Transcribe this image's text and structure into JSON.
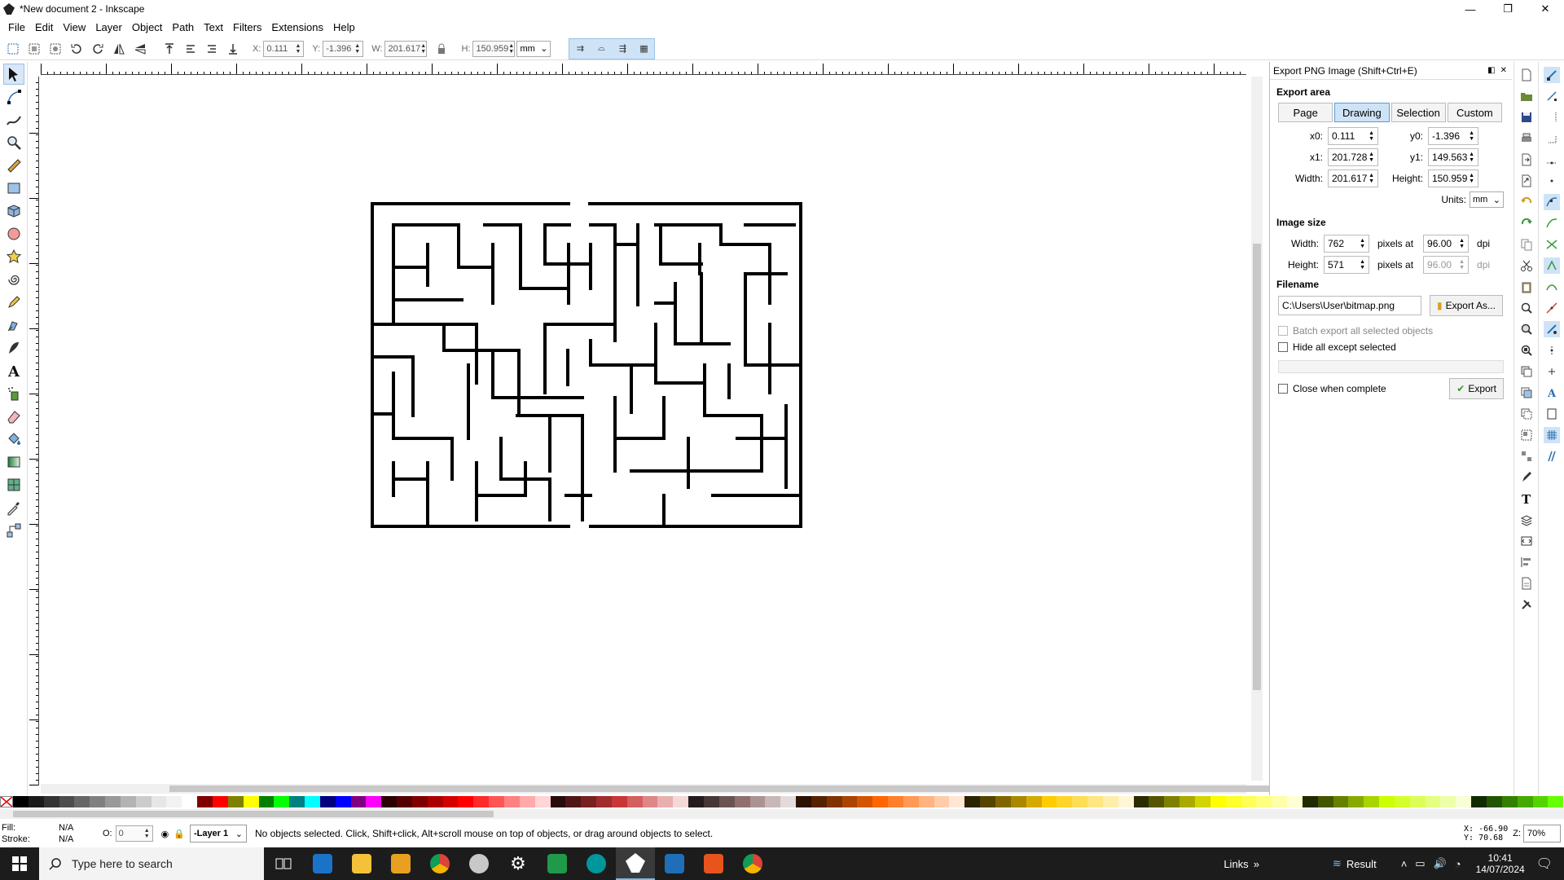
{
  "window": {
    "title": "*New document 2 - Inkscape",
    "minimize": "—",
    "restore": "❐",
    "close": "✕"
  },
  "menu": [
    "File",
    "Edit",
    "View",
    "Layer",
    "Object",
    "Path",
    "Text",
    "Filters",
    "Extensions",
    "Help"
  ],
  "toolbar": {
    "x_label": "X:",
    "x_value": "0.111",
    "y_label": "Y:",
    "y_value": "-1.396",
    "w_label": "W:",
    "w_value": "201.617",
    "h_label": "H:",
    "h_value": "150.959",
    "unit": "mm"
  },
  "export_panel": {
    "title": "Export PNG Image (Shift+Ctrl+E)",
    "export_area_title": "Export area",
    "area_buttons": [
      "Page",
      "Drawing",
      "Selection",
      "Custom"
    ],
    "selected_area": "Drawing",
    "x0_label": "x0:",
    "x0": "0.111",
    "y0_label": "y0:",
    "y0": "-1.396",
    "x1_label": "x1:",
    "x1": "201.728",
    "y1_label": "y1:",
    "y1": "149.563",
    "width_label": "Width:",
    "width": "201.617",
    "height_label": "Height:",
    "height": "150.959",
    "units_label": "Units:",
    "units": "mm",
    "image_size_title": "Image size",
    "img_width_label": "Width:",
    "img_width": "762",
    "img_height_label": "Height:",
    "img_height": "571",
    "pixels_at": "pixels at",
    "dpi_x": "96.00",
    "dpi_y": "96.00",
    "dpi": "dpi",
    "filename_title": "Filename",
    "filename": "C:\\Users\\User\\bitmap.png",
    "export_as": "Export As...",
    "batch_export": "Batch export all selected objects",
    "hide_except": "Hide all except selected",
    "close_when_complete": "Close when complete",
    "export": "Export"
  },
  "status": {
    "fill_label": "Fill:",
    "fill_value": "N/A",
    "stroke_label": "Stroke:",
    "stroke_value": "N/A",
    "opacity_label": "O:",
    "opacity_value": "0",
    "layer": "-Layer 1",
    "message": "No objects selected. Click, Shift+click, Alt+scroll mouse on top of objects, or drag around objects to select.",
    "x_coord": "X: -66.90",
    "y_coord": "Y:  70.68",
    "zoom_label": "Z:",
    "zoom": "70%"
  },
  "taskbar": {
    "search_placeholder": "Type here to search",
    "links": "Links",
    "result": "Result",
    "time": "10:41",
    "date": "14/07/2024"
  },
  "palette": [
    "#000000",
    "#1a1a1a",
    "#333333",
    "#4d4d4d",
    "#666666",
    "#808080",
    "#999999",
    "#b3b3b3",
    "#cccccc",
    "#e6e6e6",
    "#f2f2f2",
    "#ffffff",
    "#800000",
    "#ff0000",
    "#808000",
    "#ffff00",
    "#008000",
    "#00ff00",
    "#008080",
    "#00ffff",
    "#000080",
    "#0000ff",
    "#800080",
    "#ff00ff",
    "#2b0000",
    "#550000",
    "#800000",
    "#aa0000",
    "#d40000",
    "#ff0000",
    "#ff2a2a",
    "#ff5555",
    "#ff8080",
    "#ffaaaa",
    "#ffd5d5",
    "#280b0b",
    "#501616",
    "#782121",
    "#a02c2c",
    "#c83737",
    "#d35f5f",
    "#de8787",
    "#e9afaf",
    "#f4d7d7",
    "#241c1c",
    "#483737",
    "#6c5353",
    "#916f6f",
    "#ac9393",
    "#c8b7b7",
    "#e3dbdb",
    "#2b1100",
    "#552200",
    "#803300",
    "#aa4400",
    "#d45500",
    "#ff6600",
    "#ff7f2a",
    "#ff9955",
    "#ffb380",
    "#ffccaa",
    "#ffe6d5",
    "#2b2200",
    "#554400",
    "#806600",
    "#aa8800",
    "#d4aa00",
    "#ffcc00",
    "#ffd42a",
    "#ffdd55",
    "#ffe680",
    "#ffeeaa",
    "#fff6d5",
    "#2b2b00",
    "#555500",
    "#808000",
    "#aaaa00",
    "#d4d400",
    "#ffff00",
    "#ffff2a",
    "#ffff55",
    "#ffff80",
    "#ffffaa",
    "#ffffd5",
    "#222b00",
    "#445500",
    "#668000",
    "#88aa00",
    "#aad400",
    "#ccff00",
    "#d4ff2a",
    "#ddff55",
    "#e5ff80",
    "#eeffaa",
    "#f6ffd5",
    "#112b00",
    "#225500",
    "#338000",
    "#44aa00",
    "#55d400",
    "#66ff00"
  ]
}
